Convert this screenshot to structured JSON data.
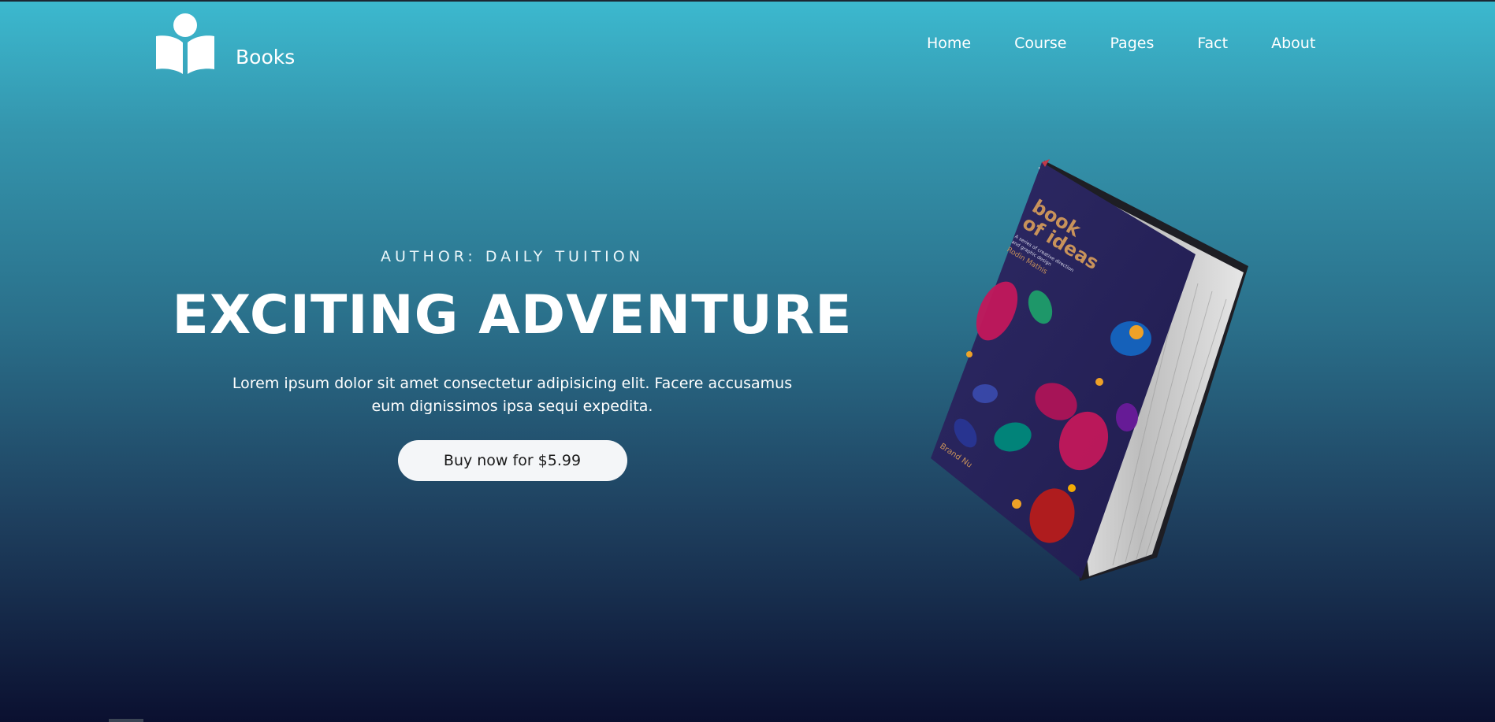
{
  "brand": {
    "name": "Books",
    "logo_icon": "book-reader-icon"
  },
  "nav": {
    "items": [
      {
        "label": "Home"
      },
      {
        "label": "Course"
      },
      {
        "label": "Pages"
      },
      {
        "label": "Fact"
      },
      {
        "label": "About"
      }
    ]
  },
  "hero": {
    "author": "AUTHOR: DAILY TUITION",
    "title": "EXCITING ADVENTURE",
    "description": "Lorem ipsum dolor sit amet consectetur adipisicing elit. Facere accusamus eum dignissimos ipsa sequi expedita.",
    "cta_label": "Buy now for $5.99"
  },
  "book": {
    "cover_title": "book of ideas",
    "cover_subtitle": "A series of creative direction and graphic design",
    "cover_author": "Rodin Mathis",
    "cover_brand": "Brand Nu"
  },
  "colors": {
    "bg_top": "#3cb9cf",
    "bg_bottom": "#0b1030",
    "cover": "#2a2560",
    "cover_text": "#c8925a",
    "button_bg": "#f4f6f8"
  }
}
